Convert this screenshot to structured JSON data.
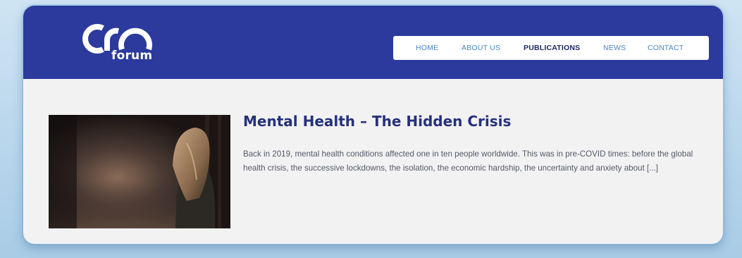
{
  "logo": {
    "word": "forum"
  },
  "nav": {
    "items": [
      {
        "label": "HOME",
        "active": false
      },
      {
        "label": "ABOUT US",
        "active": false
      },
      {
        "label": "PUBLICATIONS",
        "active": true
      },
      {
        "label": "NEWS",
        "active": false
      },
      {
        "label": "CONTACT",
        "active": false
      }
    ]
  },
  "post": {
    "title": "Mental Health – The Hidden Crisis",
    "excerpt": "Back in 2019, mental health conditions affected one in ten people worldwide. This was in pre-COVID times: before the global health crisis, the successive lockdowns, the isolation, the economic hardship, the uncertainty and anxiety about [...]"
  },
  "colors": {
    "header_bg": "#2b3a9c",
    "title": "#26307d",
    "nav_link": "#4a86c5",
    "nav_active": "#1e2866",
    "page_bg": "#f2f2f3"
  }
}
